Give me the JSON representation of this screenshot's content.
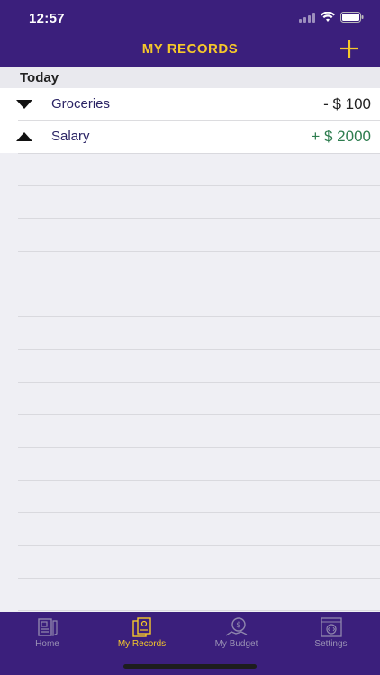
{
  "status_bar": {
    "time": "12:57"
  },
  "header": {
    "title": "MY RECORDS"
  },
  "section": {
    "title": "Today"
  },
  "records": [
    {
      "name": "Groceries",
      "amount": "- $ 100",
      "direction": "expense",
      "color": "#222222"
    },
    {
      "name": "Salary",
      "amount": "+ $ 2000",
      "direction": "income",
      "color": "#2e7d4f"
    }
  ],
  "tabs": [
    {
      "label": "Home",
      "icon": "home-icon",
      "active": false
    },
    {
      "label": "My Records",
      "icon": "records-icon",
      "active": true
    },
    {
      "label": "My Budget",
      "icon": "budget-icon",
      "active": false
    },
    {
      "label": "Settings",
      "icon": "settings-icon",
      "active": false
    }
  ],
  "colors": {
    "bar": "#3b1f7c",
    "accent": "#f6c82a"
  }
}
